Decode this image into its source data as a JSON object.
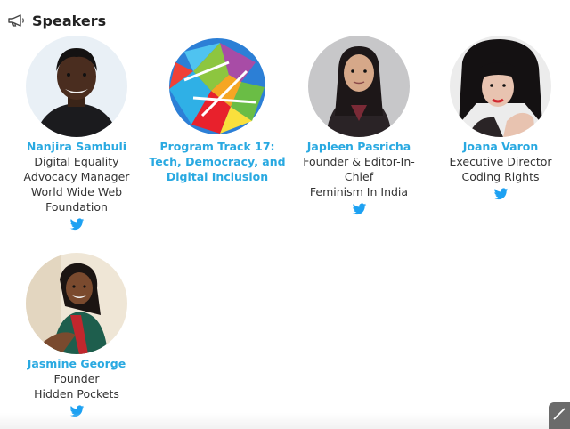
{
  "section": {
    "title": "Speakers",
    "icon": "megaphone-icon"
  },
  "speakers": [
    {
      "name": "Nanjira Sambuli",
      "lines": [
        "Digital Equality",
        "Advocacy Manager",
        "World Wide Web",
        "Foundation"
      ],
      "has_twitter": true
    },
    {
      "name_lines": [
        "Program Track 17:",
        "Tech, Democracy, and",
        "Digital Inclusion"
      ],
      "has_twitter": false
    },
    {
      "name": "Japleen Pasricha",
      "lines": [
        "Founder & Editor-In-",
        "Chief",
        "Feminism In India"
      ],
      "has_twitter": true
    },
    {
      "name": "Joana Varon",
      "lines": [
        "Executive Director",
        "Coding Rights"
      ],
      "has_twitter": true
    },
    {
      "name": "Jasmine George",
      "lines": [
        "Founder",
        "Hidden Pockets"
      ],
      "has_twitter": true
    }
  ],
  "colors": {
    "link_blue": "#29a9e1",
    "twitter_blue": "#1da1f2",
    "text": "#333333"
  }
}
